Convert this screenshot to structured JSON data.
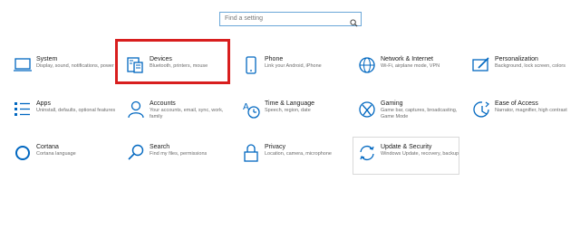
{
  "search": {
    "placeholder": "Find a setting"
  },
  "colors": {
    "accent": "#0067c0",
    "highlight": "#d81e1e"
  },
  "tiles": [
    {
      "title": "System",
      "desc": "Display, sound, notifications, power",
      "icon": "laptop-icon"
    },
    {
      "title": "Devices",
      "desc": "Bluetooth, printers, mouse",
      "icon": "keyboard-devices-icon"
    },
    {
      "title": "Phone",
      "desc": "Link your Android, iPhone",
      "icon": "phone-icon"
    },
    {
      "title": "Network & Internet",
      "desc": "Wi-Fi, airplane mode, VPN",
      "icon": "globe-icon"
    },
    {
      "title": "Personalization",
      "desc": "Background, lock screen, colors",
      "icon": "paint-tablet-icon"
    },
    {
      "title": "Apps",
      "desc": "Uninstall, defaults, optional features",
      "icon": "apps-list-icon"
    },
    {
      "title": "Accounts",
      "desc": "Your accounts, email, sync, work, family",
      "icon": "person-icon"
    },
    {
      "title": "Time & Language",
      "desc": "Speech, region, date",
      "icon": "time-language-icon"
    },
    {
      "title": "Gaming",
      "desc": "Game bar, captures, broadcasting, Game Mode",
      "icon": "xbox-icon"
    },
    {
      "title": "Ease of Access",
      "desc": "Narrator, magnifier, high contrast",
      "icon": "ease-of-access-icon"
    },
    {
      "title": "Cortana",
      "desc": "Cortana language",
      "icon": "cortana-circle-icon"
    },
    {
      "title": "Search",
      "desc": "Find my files, permissions",
      "icon": "search-icon"
    },
    {
      "title": "Privacy",
      "desc": "Location, camera, microphone",
      "icon": "lock-icon"
    },
    {
      "title": "Update & Security",
      "desc": "Windows Update, recovery, backup",
      "icon": "sync-arrows-icon"
    }
  ]
}
